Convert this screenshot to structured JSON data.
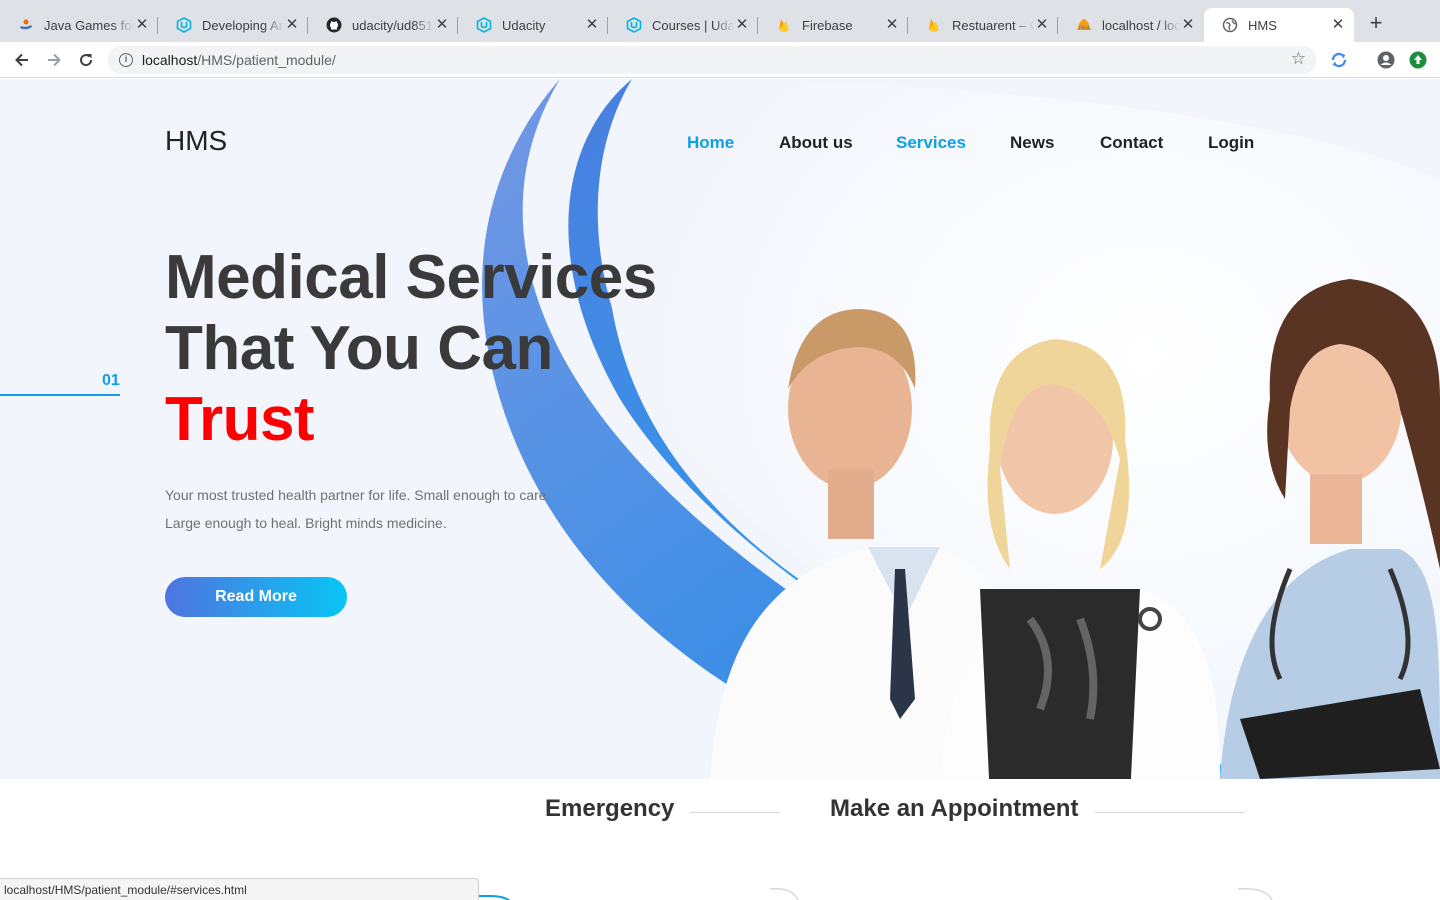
{
  "browser": {
    "tabs": [
      {
        "title": "Java Games for",
        "icon": "java-games-icon"
      },
      {
        "title": "Developing And",
        "icon": "udacity-icon"
      },
      {
        "title": "udacity/ud851-",
        "icon": "github-icon"
      },
      {
        "title": "Udacity",
        "icon": "udacity-icon"
      },
      {
        "title": "Courses | Udac",
        "icon": "udacity-icon"
      },
      {
        "title": "Firebase",
        "icon": "firebase-icon"
      },
      {
        "title": "Restuarent – O",
        "icon": "firebase-icon"
      },
      {
        "title": "localhost / loca",
        "icon": "phpmyadmin-icon"
      },
      {
        "title": "HMS",
        "icon": "globe-icon"
      }
    ],
    "active_tab_index": 8,
    "url_host": "localhost",
    "url_path": "/HMS/patient_module/",
    "status_url": "localhost/HMS/patient_module/#services.html"
  },
  "site": {
    "logo": "HMS",
    "nav": [
      {
        "label": "Home",
        "active": true
      },
      {
        "label": "About us",
        "active": false
      },
      {
        "label": "Services",
        "active": true
      },
      {
        "label": "News",
        "active": false
      },
      {
        "label": "Contact",
        "active": false
      },
      {
        "label": "Login",
        "active": false
      }
    ],
    "accent_color": "#0e9fe6",
    "highlight_color": "#ff0000"
  },
  "hero": {
    "slide_number": "01",
    "headline_line1": "Medical Services",
    "headline_line2": "That You Can",
    "headline_line3": "Trust",
    "lead_line1": "Your most trusted health partner for life. Small enough to care.",
    "lead_line2": "Large enough to heal. Bright minds medicine.",
    "button_label": "Read More"
  },
  "sections": {
    "emergency_title": "Emergency",
    "appointment_title": "Make an Appointment"
  }
}
